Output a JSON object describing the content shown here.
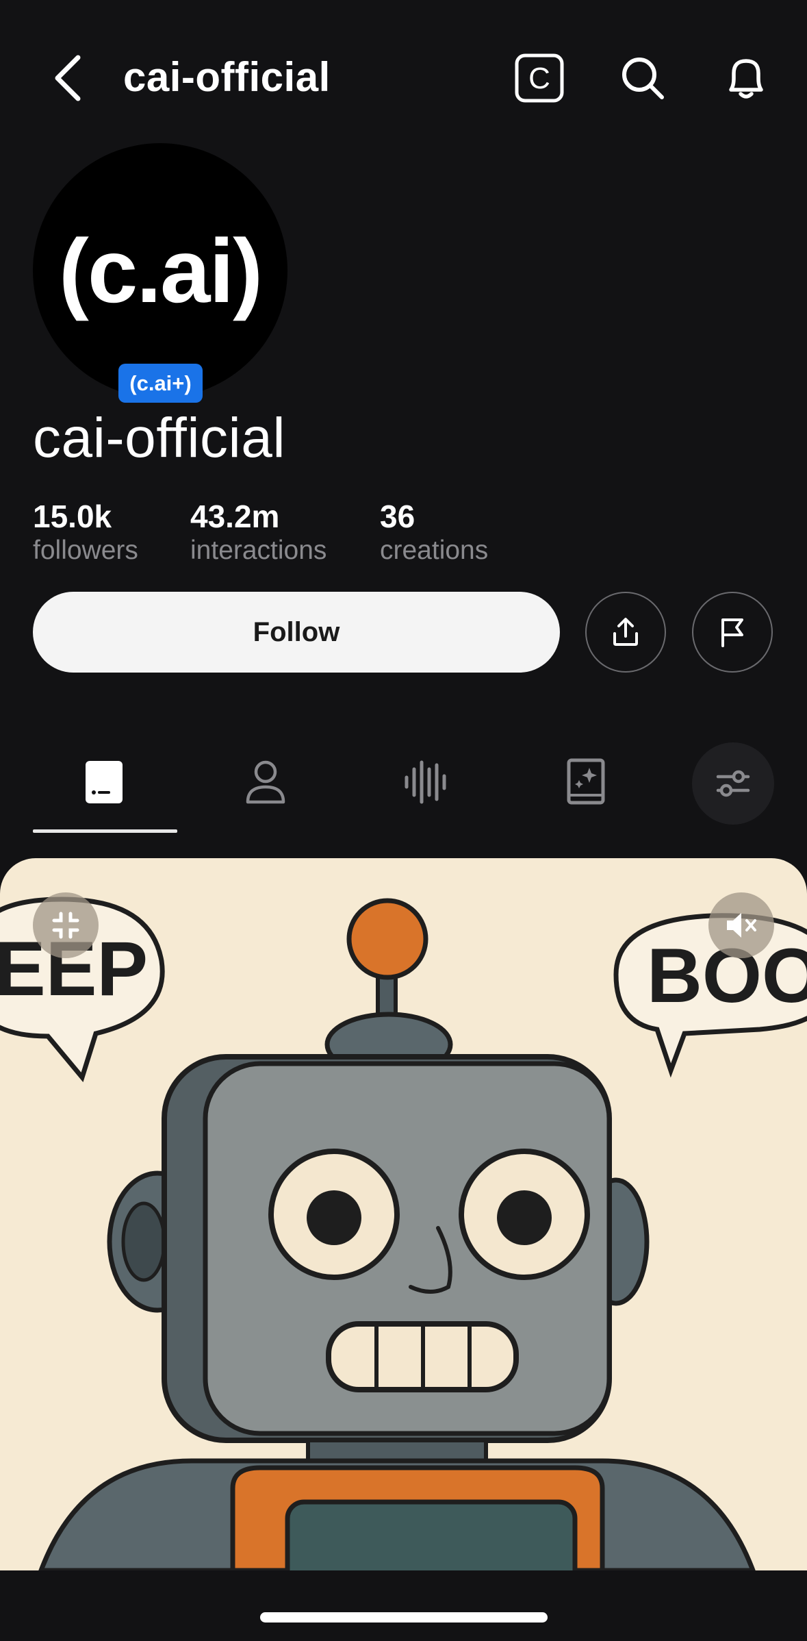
{
  "header": {
    "title": "cai-official",
    "icons": [
      "back-icon",
      "c-logo-icon",
      "search-icon",
      "bell-icon"
    ]
  },
  "profile": {
    "avatar_text": "(c.ai)",
    "badge": "(c.ai+)",
    "name": "cai-official",
    "stats": [
      {
        "value": "15.0k",
        "label": "followers"
      },
      {
        "value": "43.2m",
        "label": "interactions"
      },
      {
        "value": "36",
        "label": "creations"
      }
    ],
    "follow_label": "Follow"
  },
  "tabs": [
    {
      "icon": "characters-icon",
      "selected": true
    },
    {
      "icon": "person-icon",
      "selected": false
    },
    {
      "icon": "voice-icon",
      "selected": false
    },
    {
      "icon": "book-icon",
      "selected": false
    }
  ],
  "media": {
    "bubble_left_text": "EEP",
    "bubble_right_text": "BOO",
    "controls": [
      "minimize-icon",
      "mute-icon"
    ]
  },
  "colors": {
    "background": "#121214",
    "badge": "#1a73e8",
    "follow_button": "#f4f4f4",
    "card_background": "#f6ead3"
  }
}
